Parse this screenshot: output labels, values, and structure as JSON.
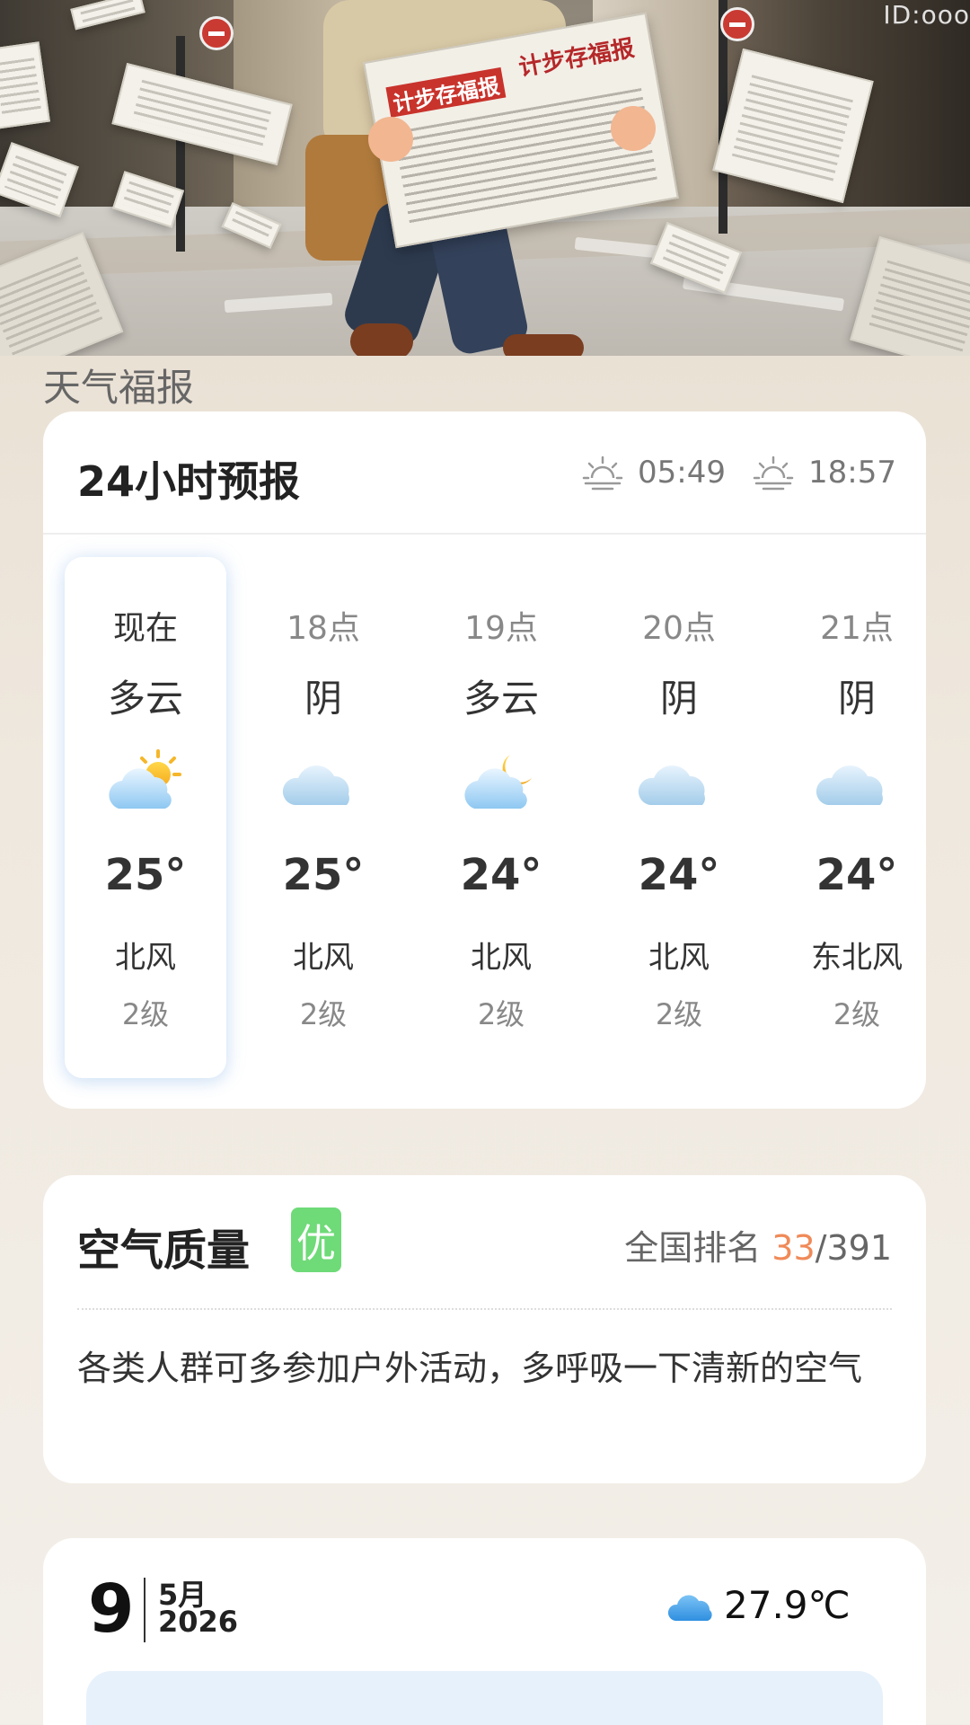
{
  "banner": {
    "newspaper_title": "计步存福报",
    "id_tag": "ID:ooo"
  },
  "section_title": "天气福报",
  "forecast": {
    "title": "24小时预报",
    "sunrise": "05:49",
    "sunset": "18:57",
    "hours": [
      {
        "time": "现在",
        "condition": "多云",
        "icon": "partly-cloudy-day-icon",
        "temp": "25°",
        "wind": "北风",
        "level": "2级"
      },
      {
        "time": "18点",
        "condition": "阴",
        "icon": "overcast-cloud-icon",
        "temp": "25°",
        "wind": "北风",
        "level": "2级"
      },
      {
        "time": "19点",
        "condition": "多云",
        "icon": "partly-cloudy-night-icon",
        "temp": "24°",
        "wind": "北风",
        "level": "2级"
      },
      {
        "time": "20点",
        "condition": "阴",
        "icon": "overcast-cloud-icon",
        "temp": "24°",
        "wind": "北风",
        "level": "2级"
      },
      {
        "time": "21点",
        "condition": "阴",
        "icon": "overcast-cloud-icon",
        "temp": "24°",
        "wind": "东北风",
        "level": "2级"
      }
    ]
  },
  "air_quality": {
    "title": "空气质量",
    "grade": "优",
    "rank_label": "全国排名",
    "rank": "33",
    "rank_total": "/391",
    "tip": "各类人群可多参加户外活动，多呼吸一下清新的空气",
    "colors": {
      "grade": "#6fda78",
      "rank": "#f08a58"
    }
  },
  "calendar": {
    "day": "9",
    "month": "5月",
    "year": "2026",
    "current_temp": "27.9℃",
    "current_icon": "cloud-icon"
  }
}
